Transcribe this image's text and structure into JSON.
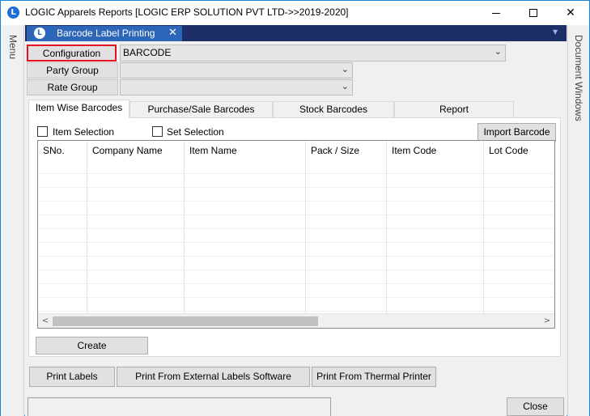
{
  "window": {
    "title": "LOGIC Apparels Reports  [LOGIC ERP SOLUTION PVT LTD->>2019-2020]",
    "app_icon": "logic-logo",
    "minimize_icon": "minimize-icon",
    "maximize_icon": "maximize-icon",
    "close_glyph": "✕"
  },
  "left_rail": {
    "label": "Menu"
  },
  "right_rail": {
    "label": "Document Windows"
  },
  "document_tab": {
    "label": "Barcode Label Printing",
    "close_glyph": "✕",
    "strip_arrow": "▼"
  },
  "form": {
    "configuration": {
      "label": "Configuration",
      "value": "BARCODE"
    },
    "party_group": {
      "label": "Party Group",
      "value": ""
    },
    "rate_group": {
      "label": "Rate Group",
      "value": ""
    },
    "combo_arrow": "⌄"
  },
  "tabs": [
    {
      "label": "Item Wise Barcodes",
      "active": true
    },
    {
      "label": "Purchase/Sale Barcodes",
      "active": false
    },
    {
      "label": "Stock Barcodes",
      "active": false
    },
    {
      "label": "Report",
      "active": false
    }
  ],
  "panel": {
    "item_selection_label": "Item Selection",
    "set_selection_label": "Set Selection",
    "import_button": "Import Barcode",
    "create_button": "Create"
  },
  "grid": {
    "columns": [
      "SNo.",
      "Company Name",
      "Item Name",
      "Pack / Size",
      "Item Code",
      "Lot Code"
    ],
    "rows": [],
    "scroll_left": "<",
    "scroll_right": ">"
  },
  "actions": {
    "print_labels": "Print Labels",
    "print_external": "Print From External Labels Software",
    "print_thermal": "Print From Thermal Printer",
    "close": "Close"
  },
  "colors": {
    "accent_border": "#1883d7",
    "doc_strip": "#1c2f66",
    "doc_tab": "#2d66b8",
    "highlight_red": "#e81123"
  }
}
